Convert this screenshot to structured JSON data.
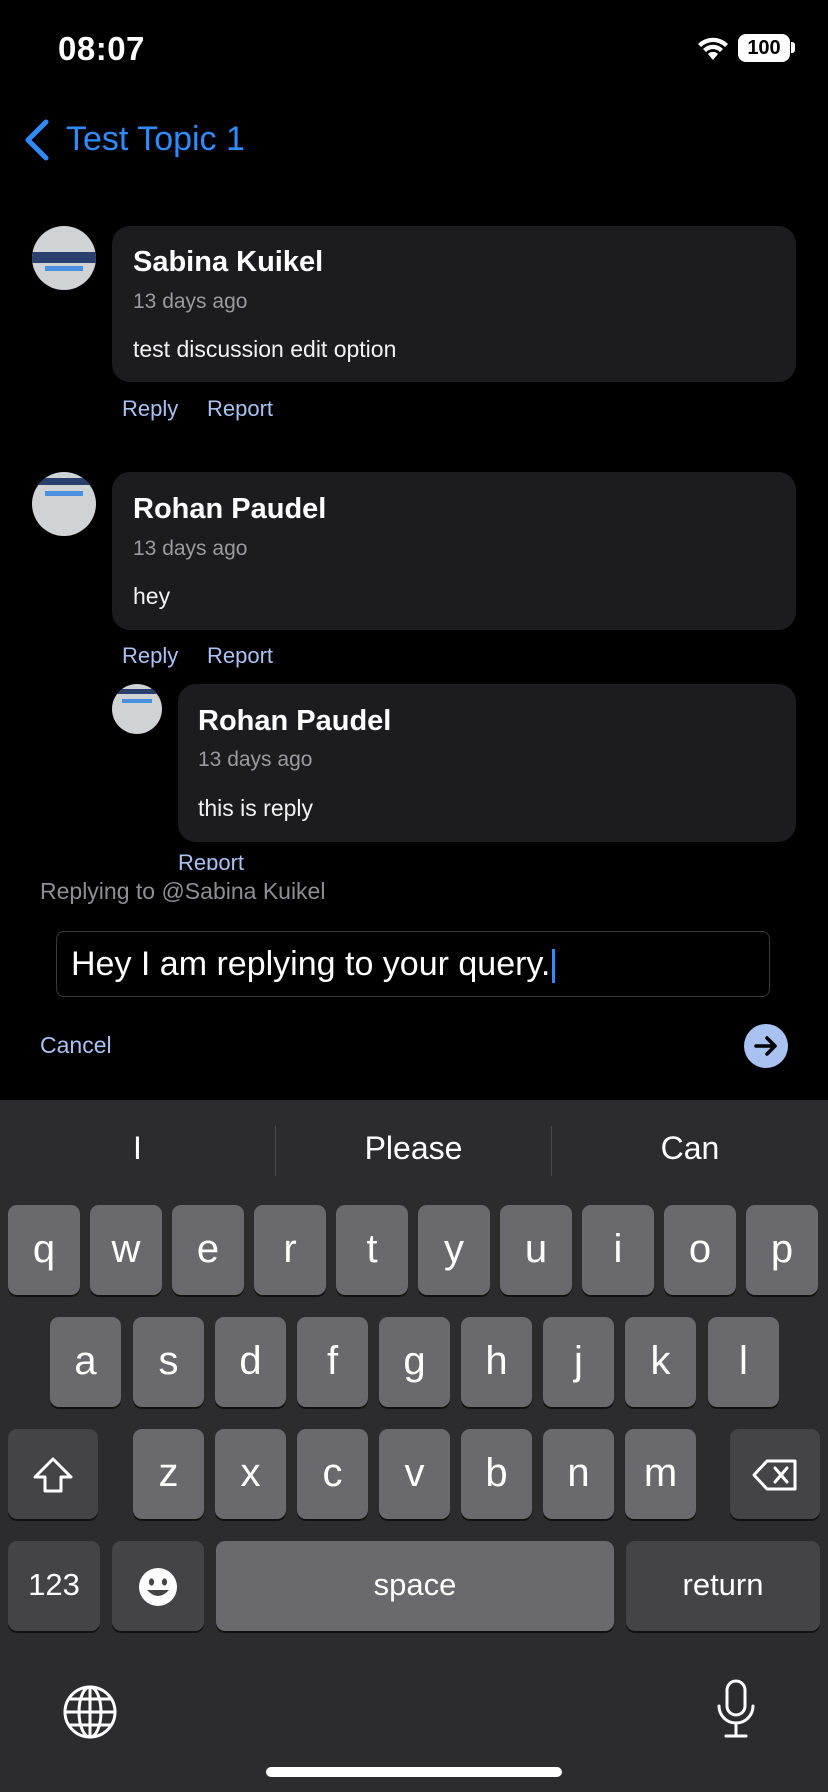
{
  "status_bar": {
    "time": "08:07",
    "battery": "100"
  },
  "nav": {
    "title": "Test Topic 1"
  },
  "posts": [
    {
      "name": "Sabina Kuikel",
      "time": "13 days ago",
      "text": "test discussion edit option",
      "reply": "Reply",
      "report": "Report"
    },
    {
      "name": "Rohan Paudel",
      "time": "13 days ago",
      "text": "hey",
      "reply": "Reply",
      "report": "Report"
    }
  ],
  "nested_reply": {
    "name": "Rohan Paudel",
    "time": "13 days ago",
    "text": "this is reply",
    "report": "Report"
  },
  "composer": {
    "replying_to": "Replying to @Sabina Kuikel",
    "value": "Hey I am replying to your query.",
    "cancel": "Cancel"
  },
  "keyboard": {
    "suggestions": [
      "I",
      "Please",
      "Can"
    ],
    "row1": [
      "q",
      "w",
      "e",
      "r",
      "t",
      "y",
      "u",
      "i",
      "o",
      "p"
    ],
    "row2": [
      "a",
      "s",
      "d",
      "f",
      "g",
      "h",
      "j",
      "k",
      "l"
    ],
    "row3": [
      "z",
      "x",
      "c",
      "v",
      "b",
      "n",
      "m"
    ],
    "numbers": "123",
    "space": "space",
    "return": "return"
  },
  "icons": [
    "wifi-icon",
    "battery-icon",
    "back-chevron-icon",
    "send-arrow-icon",
    "shift-icon",
    "backspace-icon",
    "emoji-icon",
    "globe-icon",
    "microphone-icon"
  ],
  "colors": {
    "accent": "#2f8cff",
    "link": "#a9c2f2",
    "background": "#000000",
    "bubble": "#1c1c1e",
    "keyboard": "#2c2c2e"
  }
}
